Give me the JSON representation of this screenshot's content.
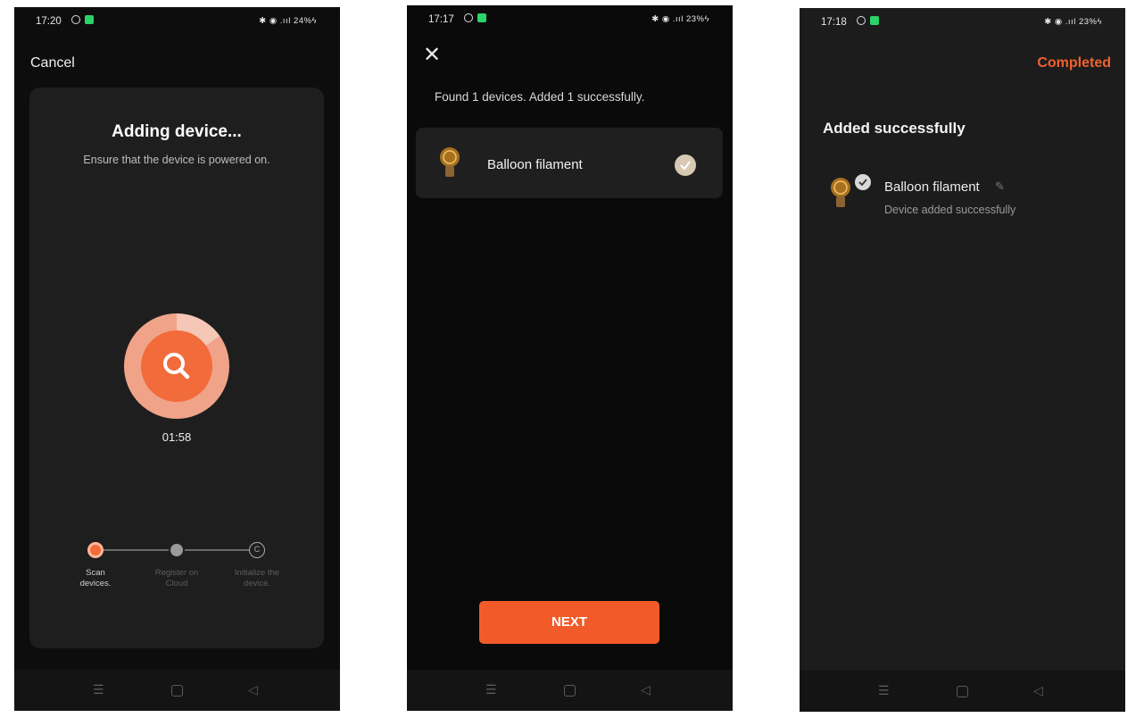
{
  "phone1": {
    "time": "17:20",
    "status_right": "✱ ◉ .ııl 24%ϟ",
    "cancel_label": "Cancel",
    "title": "Adding device...",
    "subtitle": "Ensure that the device is powered on.",
    "timer": "01:58",
    "steps": [
      {
        "label_line1": "Scan",
        "label_line2": "devices."
      },
      {
        "label_line1": "Register on",
        "label_line2": "Cloud"
      },
      {
        "label_line1": "Initialize the",
        "label_line2": "device."
      }
    ],
    "step3_icon": "C"
  },
  "phone2": {
    "time": "17:17",
    "status_right": "✱ ◉ .ııl 23%ϟ",
    "found_text": "Found 1 devices. Added 1 successfully.",
    "device_name": "Balloon filament",
    "next_label": "NEXT"
  },
  "phone3": {
    "time": "17:18",
    "status_right": "✱ ◉ .ııl 23%ϟ",
    "completed_label": "Completed",
    "heading": "Added successfully",
    "device_name": "Balloon filament",
    "device_status": "Device added successfully"
  },
  "nav": {
    "menu": "☰",
    "back": "◁"
  },
  "colors": {
    "accent": "#f25a2a",
    "card": "#1e1e1e",
    "background": "#0d0d0d"
  }
}
